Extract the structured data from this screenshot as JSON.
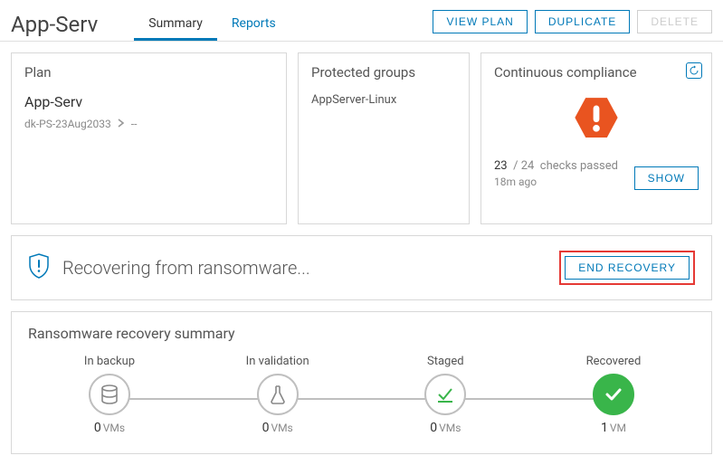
{
  "header": {
    "title": "App-Serv",
    "tabs": {
      "summary": "Summary",
      "reports": "Reports"
    },
    "actions": {
      "view_plan": "VIEW PLAN",
      "duplicate": "DUPLICATE",
      "delete": "DELETE"
    }
  },
  "plan_card": {
    "title": "Plan",
    "name": "App-Serv",
    "path_source": "dk-PS-23Aug2033",
    "path_target": "--"
  },
  "groups_card": {
    "title": "Protected groups",
    "item": "AppServer-Linux"
  },
  "compliance_card": {
    "title": "Continuous compliance",
    "passed": "23",
    "total": "24",
    "suffix": "checks passed",
    "ago": "18m ago",
    "show": "SHOW"
  },
  "banner": {
    "text": "Recovering from ransomware...",
    "end_recovery": "END RECOVERY"
  },
  "recovery_summary": {
    "title": "Ransomware recovery summary",
    "stages": {
      "backup": {
        "label": "In backup",
        "count": "0",
        "unit": "VMs"
      },
      "validation": {
        "label": "In validation",
        "count": "0",
        "unit": "VMs"
      },
      "staged": {
        "label": "Staged",
        "count": "0",
        "unit": "VMs"
      },
      "recovered": {
        "label": "Recovered",
        "count": "1",
        "unit": "VM"
      }
    }
  }
}
